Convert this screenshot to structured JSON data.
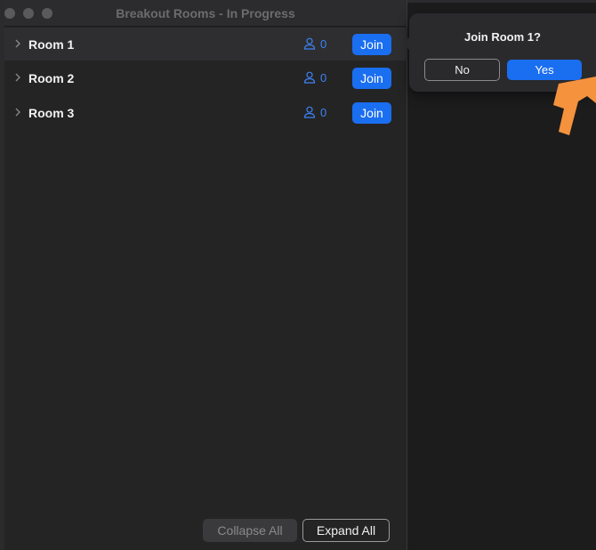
{
  "window": {
    "title": "Breakout Rooms - In Progress"
  },
  "rooms": [
    {
      "name": "Room 1",
      "count": "0",
      "join_label": "Join"
    },
    {
      "name": "Room 2",
      "count": "0",
      "join_label": "Join"
    },
    {
      "name": "Room 3",
      "count": "0",
      "join_label": "Join"
    }
  ],
  "footer": {
    "collapse_label": "Collapse All",
    "expand_label": "Expand All"
  },
  "dialog": {
    "title": "Join Room 1?",
    "no_label": "No",
    "yes_label": "Yes"
  },
  "icons": {
    "room_chevron": "chevron-right-icon",
    "participants": "person-icon",
    "pointer": "orange-arrow-pointer-icon"
  },
  "colors": {
    "accent": "#1a6ef0",
    "count_text": "#3b82f6",
    "pointer": "#f5923e"
  }
}
